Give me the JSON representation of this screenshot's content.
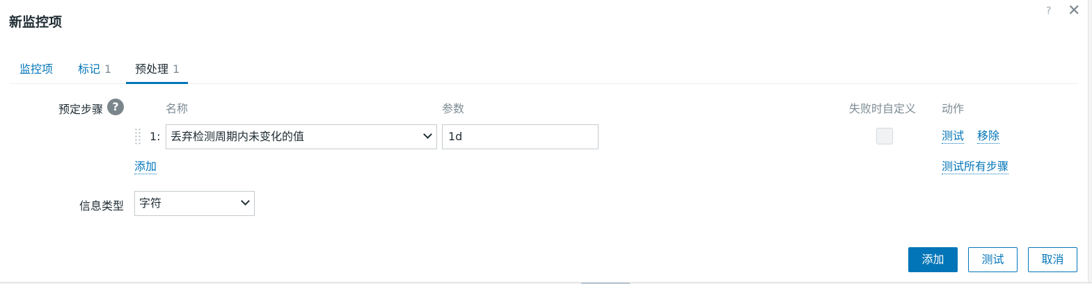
{
  "dialog": {
    "title": "新监控项",
    "help": "?",
    "close": "✕"
  },
  "tabs": [
    {
      "label": "监控项",
      "count": ""
    },
    {
      "label": "标记",
      "count": "1"
    },
    {
      "label": "预处理",
      "count": "1"
    }
  ],
  "preprocessing": {
    "label": "预定步骤",
    "help": "?",
    "headers": {
      "name": "名称",
      "params": "参数",
      "custom_on_fail": "失败时自定义",
      "actions": "动作"
    },
    "steps": [
      {
        "number": "1:",
        "name": "丢弃检测周期内未变化的值",
        "param": "1d",
        "custom_on_fail": false,
        "actions": {
          "test": "测试",
          "remove": "移除"
        }
      }
    ],
    "add_link": "添加",
    "test_all_link": "测试所有步骤"
  },
  "info_type": {
    "label": "信息类型",
    "value": "字符"
  },
  "footer": {
    "add": "添加",
    "test": "测试",
    "cancel": "取消"
  }
}
